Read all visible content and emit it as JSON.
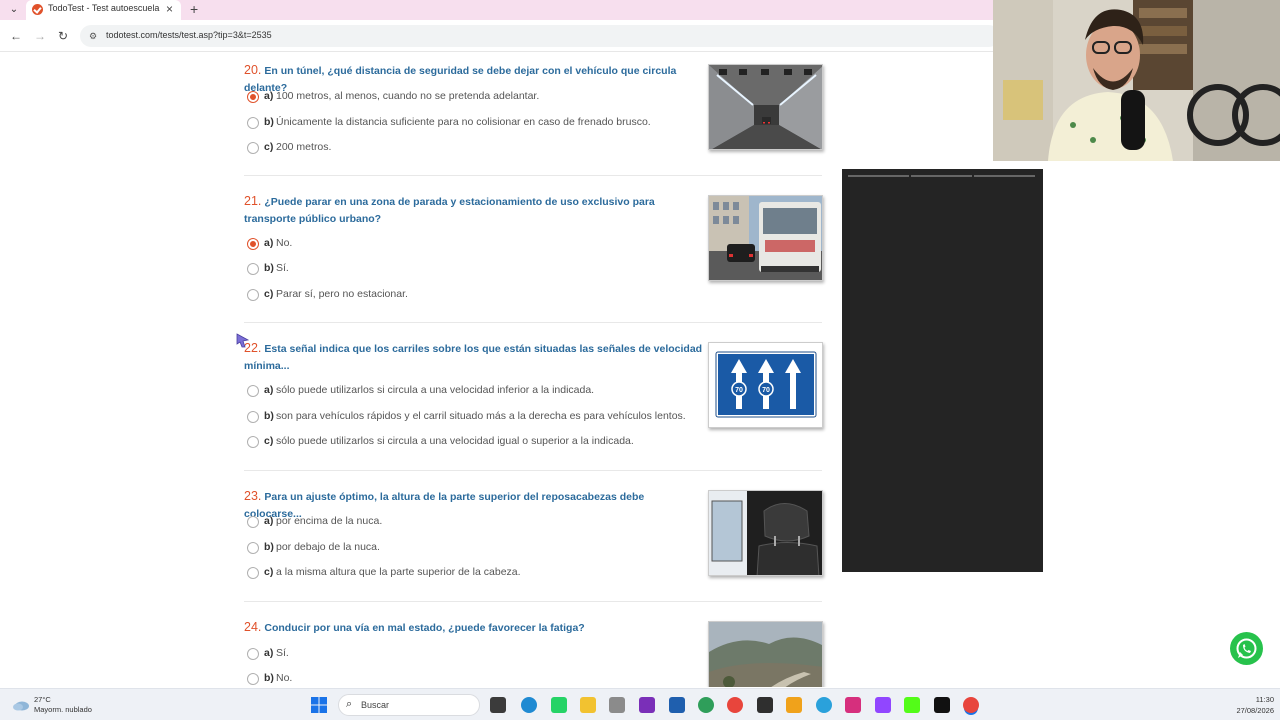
{
  "browser": {
    "tab_title": "TodoTest - Test autoescuela gra",
    "url": "todotest.com/tests/test.asp?tip=3&t=2535"
  },
  "questions": [
    {
      "number": "20.",
      "text": "En un túnel, ¿qué distancia de seguridad se debe dejar con el vehículo que circula delante?",
      "image_icon": "tunnel-photo",
      "options": [
        {
          "letter": "a)",
          "text": "100 metros, al menos, cuando no se pretenda adelantar.",
          "selected": true
        },
        {
          "letter": "b)",
          "text": "Únicamente la distancia suficiente para no colisionar en caso de frenado brusco.",
          "selected": false
        },
        {
          "letter": "c)",
          "text": "200 metros.",
          "selected": false
        }
      ]
    },
    {
      "number": "21.",
      "text": "¿Puede parar en una zona de parada y estacionamiento de uso exclusivo para transporte público urbano?",
      "image_icon": "bus-photo",
      "options": [
        {
          "letter": "a)",
          "text": "No.",
          "selected": true
        },
        {
          "letter": "b)",
          "text": "Sí.",
          "selected": false
        },
        {
          "letter": "c)",
          "text": "Parar sí, pero no estacionar.",
          "selected": false
        }
      ]
    },
    {
      "number": "22.",
      "text": "Esta señal indica que los carriles sobre los que están situadas las señales de velocidad mínima...",
      "image_icon": "minimum-speed-lanes-sign",
      "sign_speed": "70",
      "options": [
        {
          "letter": "a)",
          "text": "sólo puede utilizarlos si circula a una velocidad inferior a la indicada.",
          "selected": false
        },
        {
          "letter": "b)",
          "text": "son para vehículos rápidos y el carril situado más a la derecha es para vehículos lentos.",
          "selected": false
        },
        {
          "letter": "c)",
          "text": "sólo puede utilizarlos si circula a una velocidad igual o superior a la indicada.",
          "selected": false
        }
      ]
    },
    {
      "number": "23.",
      "text": "Para un ajuste óptimo, la altura de la parte superior del reposacabezas debe colocarse...",
      "image_icon": "headrest-photo",
      "options": [
        {
          "letter": "a)",
          "text": "por encima de la nuca.",
          "selected": false
        },
        {
          "letter": "b)",
          "text": "por debajo de la nuca.",
          "selected": false
        },
        {
          "letter": "c)",
          "text": "a la misma altura que la parte superior de la cabeza.",
          "selected": false
        }
      ]
    },
    {
      "number": "24.",
      "text": "Conducir por una vía en mal estado, ¿puede favorecer la fatiga?",
      "image_icon": "mountain-road-photo",
      "options": [
        {
          "letter": "a)",
          "text": "Sí.",
          "selected": false
        },
        {
          "letter": "b)",
          "text": "No.",
          "selected": false
        }
      ]
    }
  ],
  "taskbar": {
    "temperature": "27°C",
    "weather": "Mayorm. nublado",
    "search_label": "Buscar",
    "time": "11:30",
    "date": "27/08/2026"
  },
  "colors": {
    "accent_orange": "#e0522b",
    "question_blue": "#2c6b9c",
    "tab_bar_pink": "#f7dfee"
  }
}
